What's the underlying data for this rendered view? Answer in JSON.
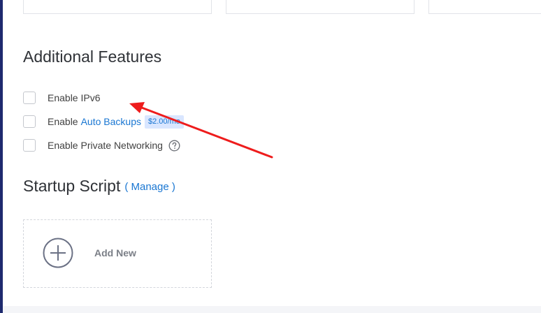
{
  "additional_features": {
    "title": "Additional Features",
    "options": [
      {
        "prefix": "Enable IPv6",
        "checked": false
      },
      {
        "prefix": "Enable",
        "link": "Auto Backups",
        "badge": "$2.00/mo",
        "checked": false
      },
      {
        "prefix": "Enable Private Networking",
        "help_icon": "question-circle-icon",
        "checked": false
      }
    ]
  },
  "startup_script": {
    "title": "Startup Script",
    "manage_label": "( Manage )",
    "add_new_label": "Add New",
    "add_icon": "plus-circle-icon"
  },
  "colors": {
    "accent": "#1976d2",
    "badge_bg": "#d9e6ff",
    "annotation": "#ee1c1c",
    "left_rail": "#1e2a6e"
  }
}
